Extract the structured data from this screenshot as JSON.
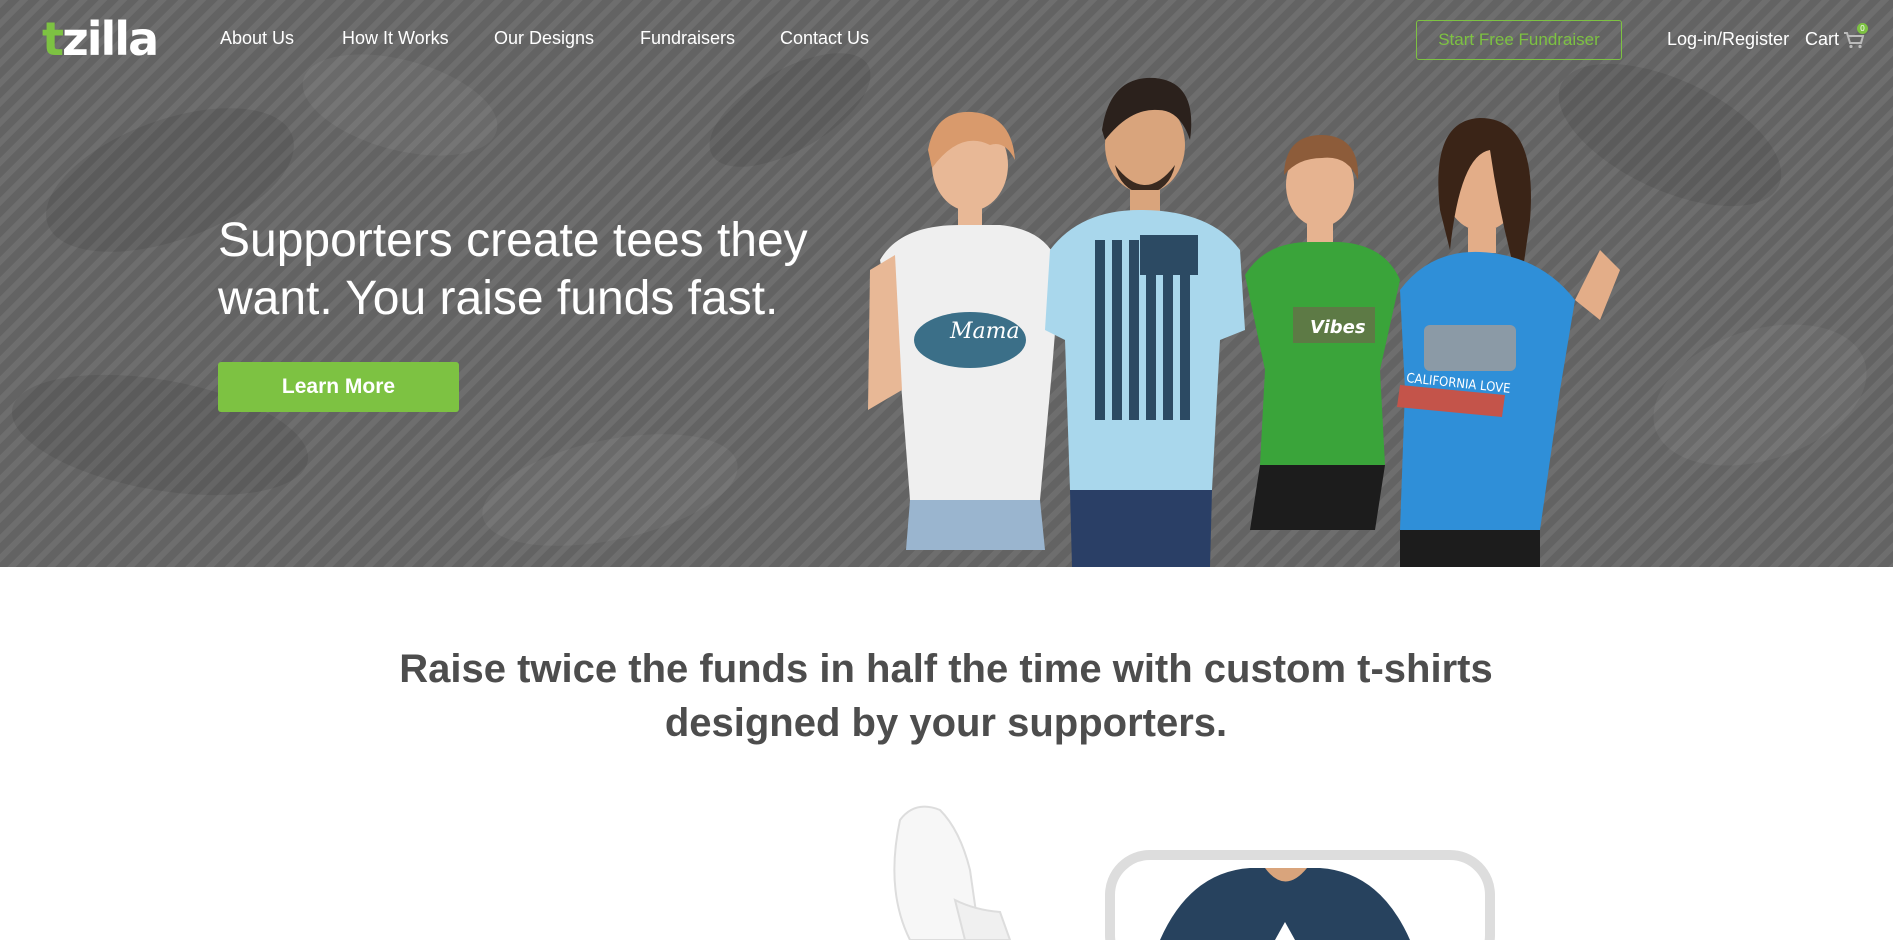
{
  "brand": {
    "logo_t": "t",
    "logo_rest": "zilla",
    "accent_color": "#7dc242"
  },
  "nav": {
    "links": [
      "About Us",
      "How It Works",
      "Our Designs",
      "Fundraisers",
      "Contact Us"
    ],
    "start_button": "Start Free Fundraiser",
    "login": "Log-in/Register",
    "cart": "Cart",
    "cart_count": "0"
  },
  "hero": {
    "heading": "Supporters create tees they want. You raise funds fast.",
    "cta": "Learn More",
    "shirts": [
      "Mama",
      "Vibes",
      "CALIFORNIA LOVE"
    ]
  },
  "section": {
    "tagline": "Raise twice the funds in half the time with custom t-shirts designed by your supporters."
  },
  "icons": {
    "cart": "cart-icon"
  }
}
